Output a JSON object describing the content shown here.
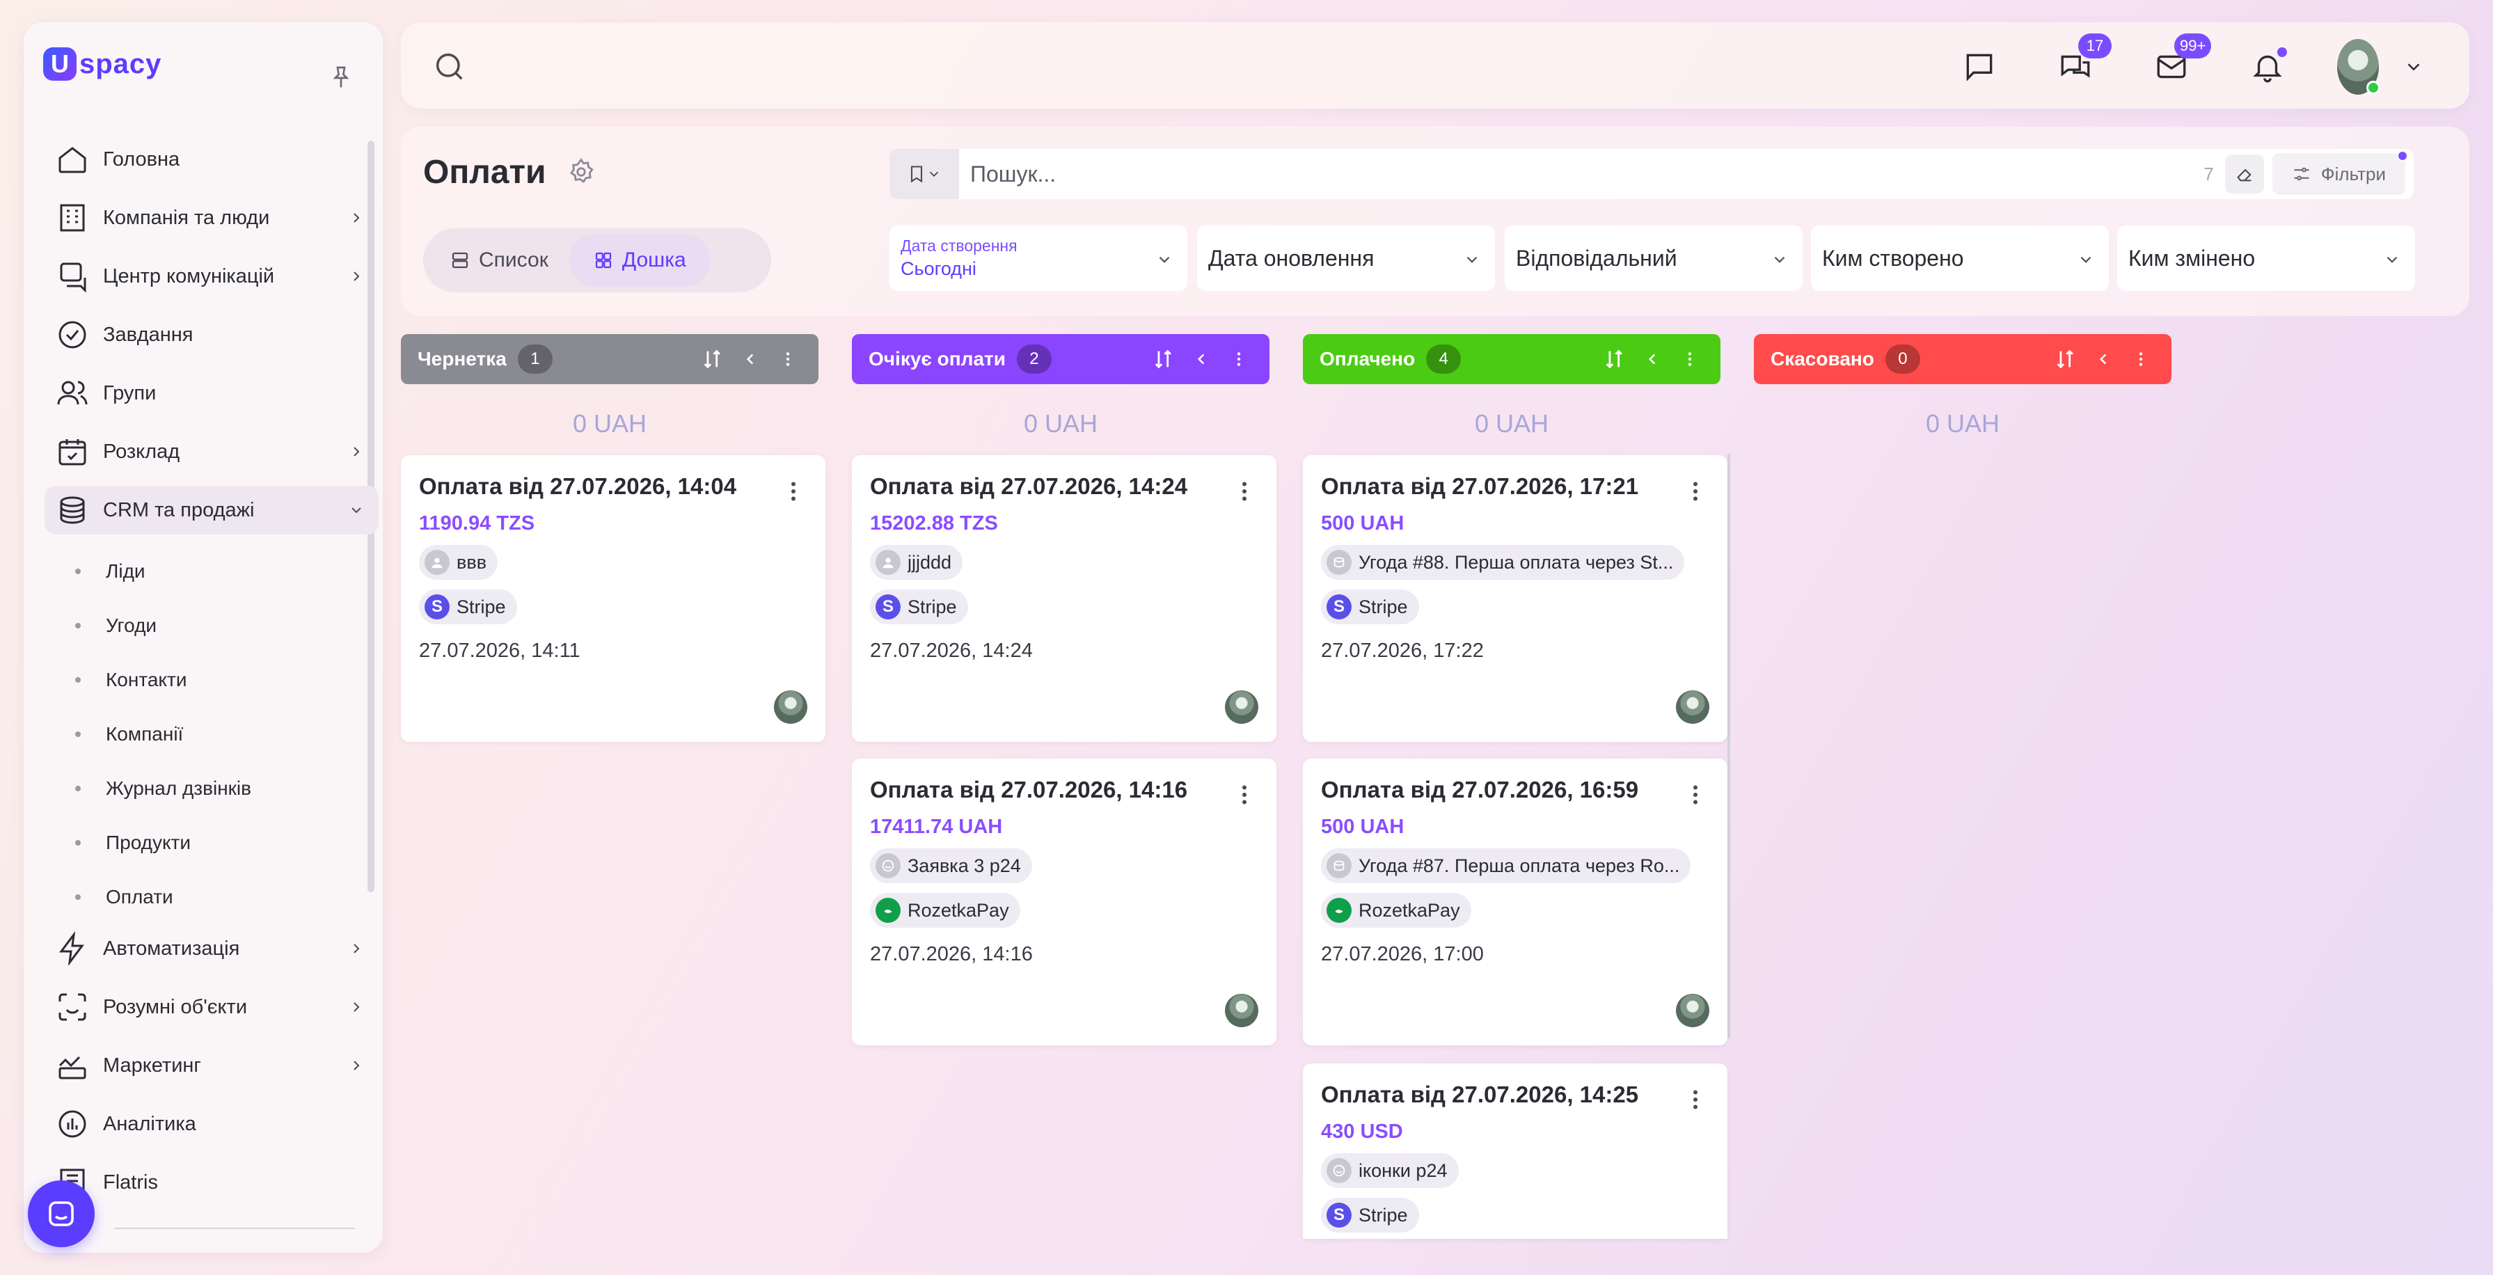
{
  "sidebar": {
    "logo": {
      "mark": "U",
      "text": "spacy"
    },
    "nav": [
      {
        "label": "Головна"
      },
      {
        "label": "Компанія та люди"
      },
      {
        "label": "Центр комунікацій"
      },
      {
        "label": "Завдання"
      },
      {
        "label": "Групи"
      },
      {
        "label": "Розклад"
      },
      {
        "label": "CRM та продажі"
      }
    ],
    "crm_sub": [
      {
        "label": "Ліди"
      },
      {
        "label": "Угоди"
      },
      {
        "label": "Контакти"
      },
      {
        "label": "Компанії"
      },
      {
        "label": "Журнал дзвінків"
      },
      {
        "label": "Продукти"
      },
      {
        "label": "Оплати"
      }
    ],
    "nav_bottom": [
      {
        "label": "Автоматизація"
      },
      {
        "label": "Розумні об'єкти"
      },
      {
        "label": "Маркетинг"
      },
      {
        "label": "Аналітика"
      },
      {
        "label": "Flatris"
      }
    ]
  },
  "header": {
    "chat_badge": "17",
    "mail_badge": "99+"
  },
  "page": {
    "title": "Оплати",
    "view_list": "Список",
    "view_board": "Дошка",
    "search_placeholder": "Пошук...",
    "search_count": "7",
    "filters_label": "Фільтри"
  },
  "filters": {
    "created": {
      "label": "Дата створення",
      "value": "Сьогодні"
    },
    "updated": "Дата оновлення",
    "responsible": "Відповідальний",
    "created_by": "Ким створено",
    "modified_by": "Ким змінено"
  },
  "columns": [
    {
      "title": "Чернетка",
      "count": "1",
      "total": "0 UAH",
      "color": "#8a8a92",
      "cards": [
        {
          "title": "Оплата від 27.07.2026, 14:04",
          "amount": "1190.94 TZS",
          "source": "ввв",
          "provider": "Stripe",
          "date": "27.07.2026, 14:11"
        }
      ]
    },
    {
      "title": "Очікує оплати",
      "count": "2",
      "total": "0 UAH",
      "color": "#8b45ff",
      "cards": [
        {
          "title": "Оплата від 27.07.2026, 14:24",
          "amount": "15202.88 TZS",
          "source": "jjjddd",
          "provider": "Stripe",
          "date": "27.07.2026, 14:24"
        },
        {
          "title": "Оплата від 27.07.2026, 14:16",
          "amount": "17411.74 UAH",
          "source": "Заявка 3 р24",
          "provider": "RozetkaPay",
          "date": "27.07.2026, 14:16"
        }
      ]
    },
    {
      "title": "Оплачено",
      "count": "4",
      "total": "0 UAH",
      "color": "#4ccb14",
      "cards": [
        {
          "title": "Оплата від 27.07.2026, 17:21",
          "amount": "500 UAH",
          "source": "Угода #88. Перша оплата через St...",
          "provider": "Stripe",
          "date": "27.07.2026, 17:22"
        },
        {
          "title": "Оплата від 27.07.2026, 16:59",
          "amount": "500 UAH",
          "source": "Угода #87. Перша оплата через Ro...",
          "provider": "RozetkaPay",
          "date": "27.07.2026, 17:00"
        },
        {
          "title": "Оплата від 27.07.2026, 14:25",
          "amount": "430 USD",
          "source": "іконки р24",
          "provider": "Stripe",
          "date": ""
        }
      ]
    },
    {
      "title": "Скасовано",
      "count": "0",
      "total": "0 UAH",
      "color": "#ff4b4b",
      "cards": []
    }
  ]
}
